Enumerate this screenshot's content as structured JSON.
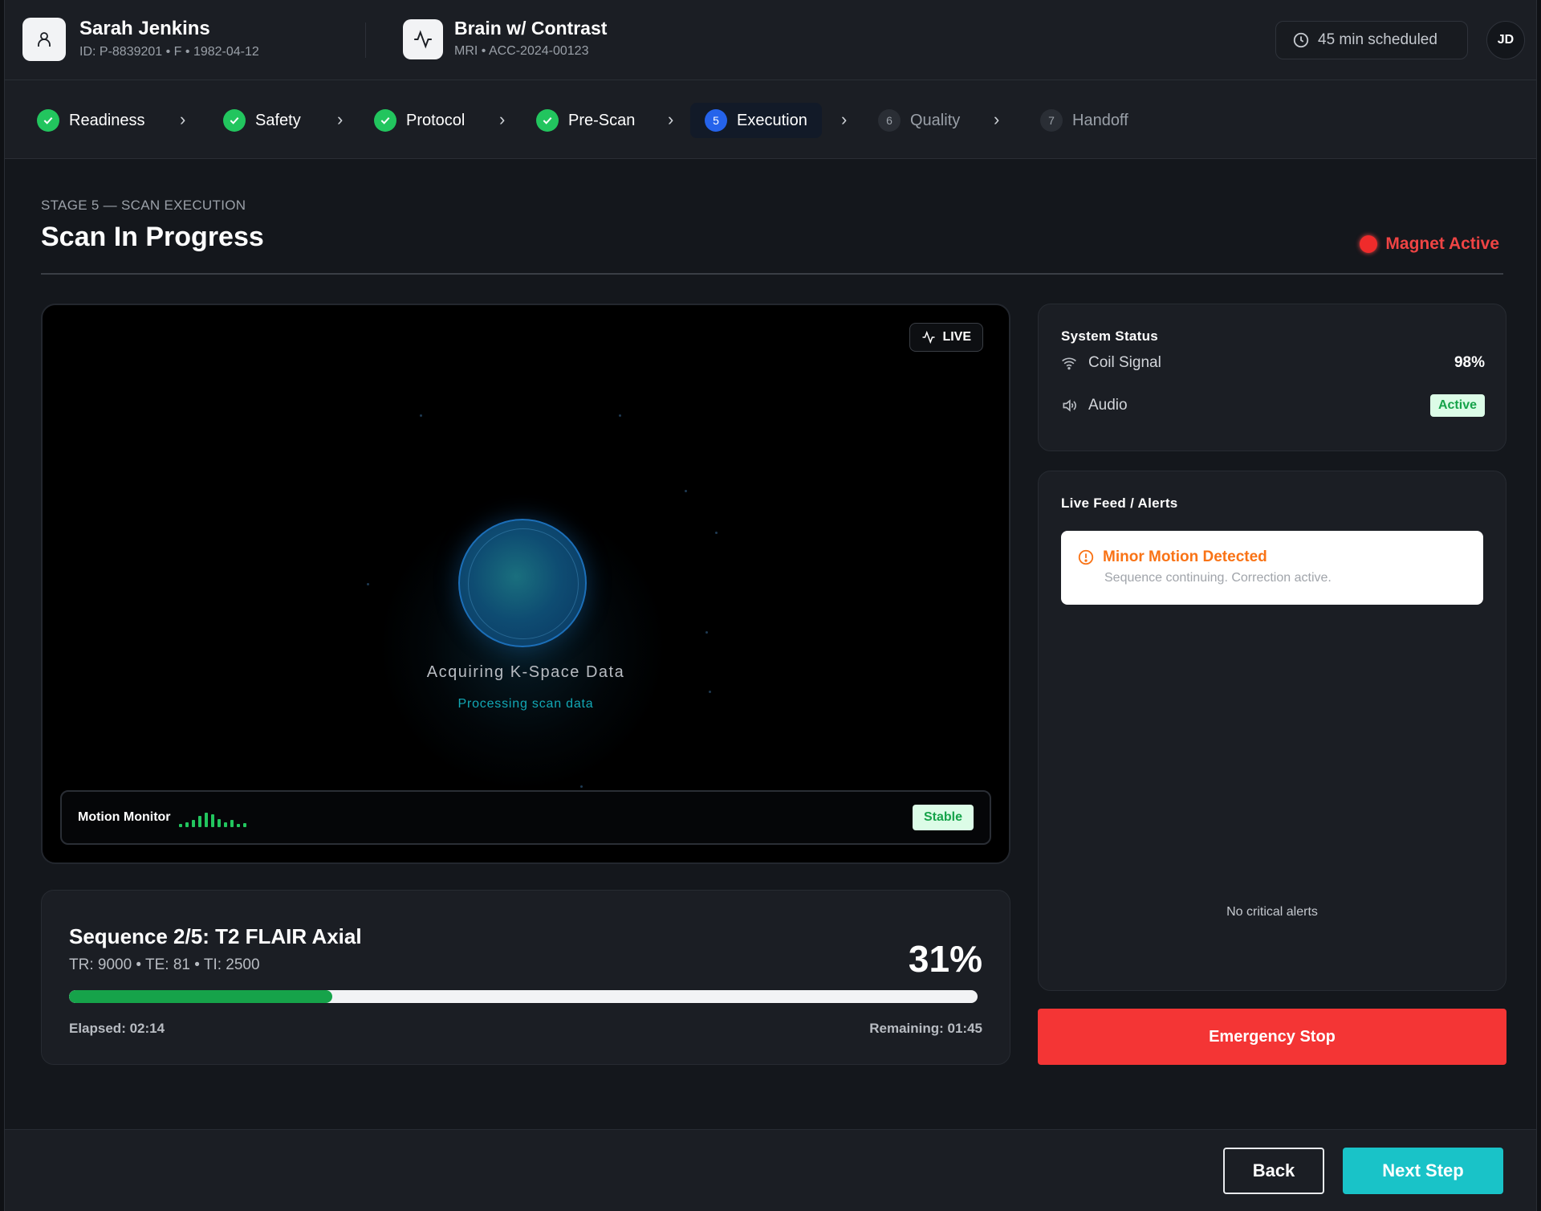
{
  "patient": {
    "name": "Sarah Jenkins",
    "meta": "ID: P-8839201 • F • 1982-04-12"
  },
  "exam": {
    "name": "Brain w/ Contrast",
    "meta": "MRI • ACC-2024-00123"
  },
  "header": {
    "schedule": "45 min scheduled",
    "user_initials": "JD"
  },
  "steps": [
    {
      "label": "Readiness",
      "state": "done"
    },
    {
      "label": "Safety",
      "state": "done"
    },
    {
      "label": "Protocol",
      "state": "done"
    },
    {
      "label": "Pre-Scan",
      "state": "done"
    },
    {
      "label": "Execution",
      "state": "active",
      "num": "5"
    },
    {
      "label": "Quality",
      "state": "pending",
      "num": "6"
    },
    {
      "label": "Handoff",
      "state": "pending",
      "num": "7"
    }
  ],
  "stage": {
    "kicker": "STAGE 5 — SCAN EXECUTION",
    "title": "Scan In Progress",
    "magnet_status": "Magnet Active"
  },
  "viewer": {
    "live_label": "LIVE",
    "acquiring": "Acquiring K-Space Data",
    "processing": "Processing scan data",
    "motion_label": "Motion Monitor",
    "motion_status": "Stable"
  },
  "sequence": {
    "title": "Sequence 2/5: T2 FLAIR Axial",
    "params": "TR: 9000 • TE: 81 • TI: 2500",
    "percent_label": "31%",
    "progress": 0.29,
    "elapsed": "Elapsed: 02:14",
    "remaining": "Remaining: 01:45"
  },
  "system_status": {
    "title": "System Status",
    "coil_label": "Coil Signal",
    "coil_value": "98%",
    "audio_label": "Audio",
    "audio_value": "Active"
  },
  "feed": {
    "title": "Live Feed / Alerts",
    "alert_title": "Minor Motion Detected",
    "alert_desc": "Sequence continuing. Correction active.",
    "empty": "No critical alerts"
  },
  "actions": {
    "emergency": "Emergency Stop",
    "back": "Back",
    "next": "Next Step"
  },
  "colors": {
    "success": "#22c55e",
    "active_step": "#2563eb",
    "danger": "#f43535",
    "primary": "#19c3c8",
    "warning": "#f97316"
  }
}
